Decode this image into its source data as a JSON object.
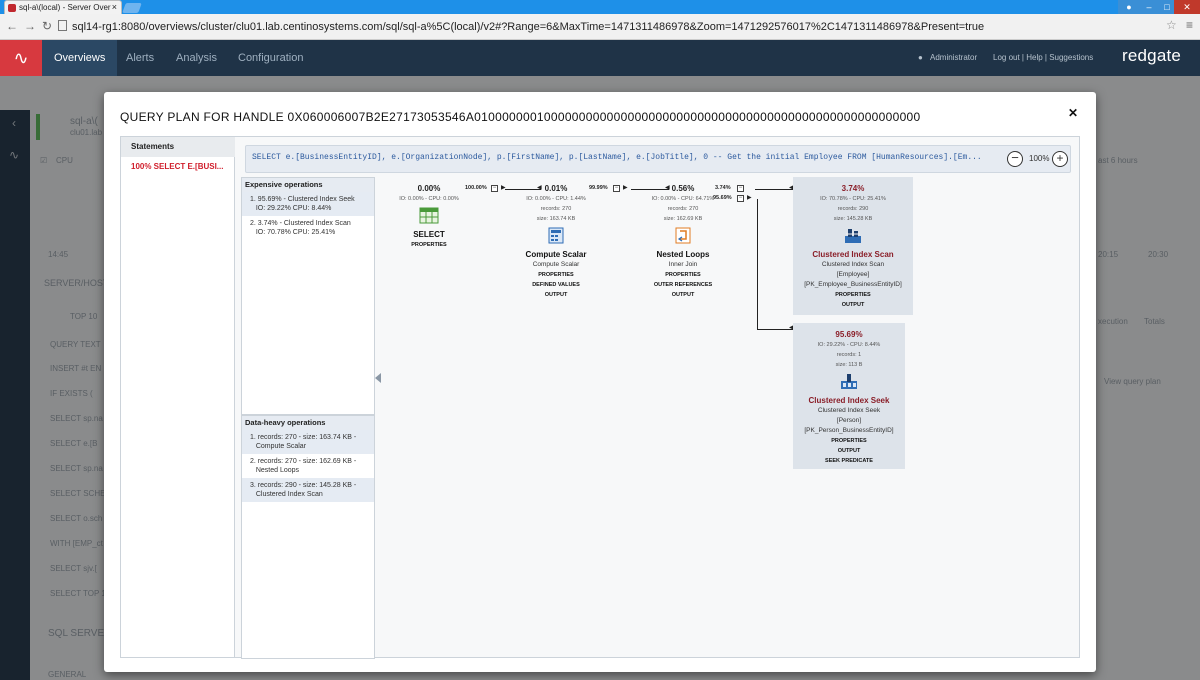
{
  "browser": {
    "tab_title": "sql-a\\(local) - Server Over",
    "url": "sql14-rg1:8080/overviews/cluster/clu01.lab.centinosystems.com/sql/sql-a%5C(local)/v2#?Range=6&MaxTime=1471311486978&Zoom=1471292576017%2C1471311486978&Present=true"
  },
  "app": {
    "nav": {
      "overview": "Overviews",
      "alerts": "Alerts",
      "analysis": "Analysis",
      "configuration": "Configuration"
    },
    "user": "Administrator",
    "links": "Log out | Help | Suggestions",
    "brand": "redgate"
  },
  "background": {
    "header_title": "sql-a\\(",
    "header_sub": "clu01.lab",
    "cpu_label": "CPU",
    "time_left": "14:45",
    "time_right1": "20:15",
    "time_right2": "20:30",
    "range_label": "ast 6 hours",
    "server_host": "SERVER/HOST",
    "top_label": "TOP 10",
    "query_text_header": "QUERY TEXT",
    "execution": "xecution",
    "totals": "Totals",
    "view_plan": "View query plan",
    "query_rows": [
      "INSERT #t EN",
      "IF EXISTS (",
      "SELECT sp.na",
      "SELECT e.[B",
      "SELECT sp.na",
      "SELECT SCHE",
      "SELECT o.sch",
      "WITH [EMP_ct",
      "SELECT sjv.[",
      "SELECT TOP 1"
    ],
    "sql_server": "SQL SERVE",
    "general": "GENERAL"
  },
  "modal": {
    "title": "QUERY PLAN FOR HANDLE 0X060006007B2E27173053546A0100000001000000000000000000000000000000000000000000000000000000",
    "statements_header": "Statements",
    "statement_item": "100% SELECT E.[BUSI...",
    "query": "SELECT e.[BusinessEntityID], e.[OrganizationNode], p.[FirstName], p.[LastName], e.[JobTitle], 0 -- Get the initial Employee FROM [HumanResources].[Em...",
    "zoom": "100%",
    "expensive_header": "Expensive operations",
    "expensive": [
      {
        "num": "1.",
        "line1": "95.69% - Clustered Index Seek",
        "line2": "IO: 29.22% CPU: 8.44%"
      },
      {
        "num": "2.",
        "line1": "3.74% - Clustered Index Scan",
        "line2": "IO: 70.78% CPU: 25.41%"
      }
    ],
    "data_header": "Data-heavy operations",
    "data_heavy": [
      {
        "num": "1.",
        "line1": "records: 270 - size: 163.74 KB -",
        "line2": "Compute Scalar"
      },
      {
        "num": "2.",
        "line1": "records: 270 - size: 162.69 KB -",
        "line2": "Nested Loops"
      },
      {
        "num": "3.",
        "line1": "records: 290 - size: 145.28 KB -",
        "line2": "Clustered Index Scan"
      }
    ]
  },
  "plan": {
    "select": {
      "pct": "0.00%",
      "io": "IO: 0.00% - CPU: 0.00%",
      "title": "SELECT",
      "links": [
        "PROPERTIES"
      ]
    },
    "compute": {
      "pct": "0.01%",
      "io": "IO: 0.00% - CPU: 1.44%",
      "records": "records: 270",
      "size": "size: 163.74 KB",
      "title": "Compute Scalar",
      "sub": [
        "Compute Scalar"
      ],
      "links": [
        "PROPERTIES",
        "DEFINED VALUES",
        "OUTPUT"
      ]
    },
    "loops": {
      "pct": "0.56%",
      "io": "IO: 0.00% - CPU: 64.71%",
      "records": "records: 270",
      "size": "size: 162.69 KB",
      "title": "Nested Loops",
      "sub": [
        "Inner Join"
      ],
      "links": [
        "PROPERTIES",
        "OUTER REFERENCES",
        "OUTPUT"
      ]
    },
    "scan": {
      "pct": "3.74%",
      "io": "IO: 70.78% - CPU: 25.41%",
      "records": "records: 290",
      "size": "size: 145.28 KB",
      "title": "Clustered Index Scan",
      "sub": [
        "Clustered Index Scan",
        "[Employee]",
        "[PK_Employee_BusinessEntityID]"
      ],
      "links": [
        "PROPERTIES",
        "OUTPUT"
      ]
    },
    "seek": {
      "pct": "95.69%",
      "io": "IO: 29.22% - CPU: 8.44%",
      "records": "records: 1",
      "size": "size: 113 B",
      "title": "Clustered Index Seek",
      "sub": [
        "Clustered Index Seek",
        "[Person]",
        "[PK_Person_BusinessEntityID]"
      ],
      "links": [
        "PROPERTIES",
        "OUTPUT",
        "SEEK PREDICATE"
      ]
    },
    "conn_labels": {
      "c1": "100.00%",
      "c2": "99.99%",
      "c3a": "3.74%",
      "c3b": "95.69%"
    }
  }
}
